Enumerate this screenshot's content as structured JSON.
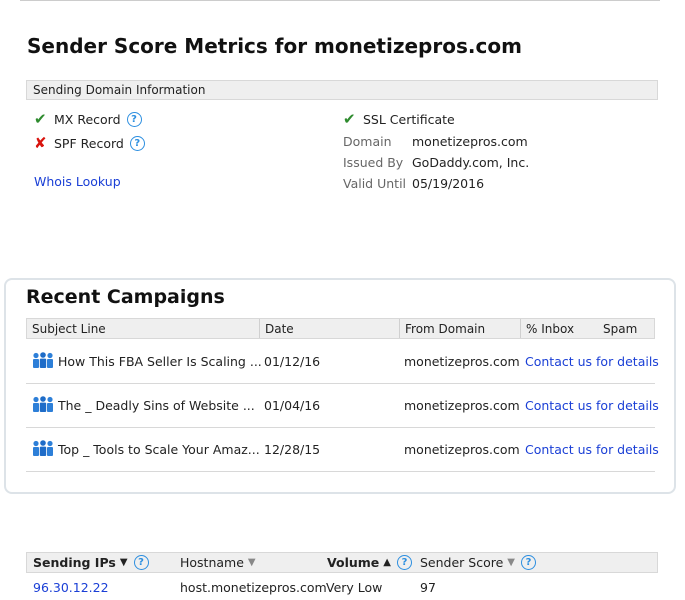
{
  "metrics": {
    "title": "Sender Score Metrics for monetizepros.com",
    "domain_section": "Sending Domain Information",
    "mx_label": "MX Record",
    "spf_label": "SPF Record",
    "whois_label": "Whois Lookup",
    "ssl": {
      "label": "SSL Certificate",
      "domain_key": "Domain",
      "domain_val": "monetizepros.com",
      "issued_key": "Issued By",
      "issued_val": "GoDaddy.com, Inc.",
      "valid_key": "Valid Until",
      "valid_val": "05/19/2016"
    },
    "colors": {
      "check": "#2e8b2e",
      "cross": "#d9140e",
      "link": "#1a3fd6",
      "help": "#2d8fe0"
    }
  },
  "campaigns": {
    "title": "Recent Campaigns",
    "columns": {
      "subject": "Subject Line",
      "date": "Date",
      "from": "From Domain",
      "inbox": "% Inbox",
      "spam": "Spam"
    },
    "rows": [
      {
        "subject": "How This FBA Seller Is Scaling ...",
        "date": "01/12/16",
        "from": "monetizepros.com",
        "contact": "Contact us for details"
      },
      {
        "subject": "The _ Deadly Sins of Website ...",
        "date": "01/04/16",
        "from": "monetizepros.com",
        "contact": "Contact us for details"
      },
      {
        "subject": "Top _ Tools to Scale Your Amaz...",
        "date": "12/28/15",
        "from": "monetizepros.com",
        "contact": "Contact us for details"
      }
    ]
  },
  "ips": {
    "columns": {
      "ip": "Sending IPs",
      "hostname": "Hostname",
      "volume": "Volume",
      "score": "Sender Score"
    },
    "rows": [
      {
        "ip": "96.30.12.22",
        "hostname": "host.monetizepros.com",
        "volume": "Very Low",
        "score": "97"
      }
    ]
  }
}
